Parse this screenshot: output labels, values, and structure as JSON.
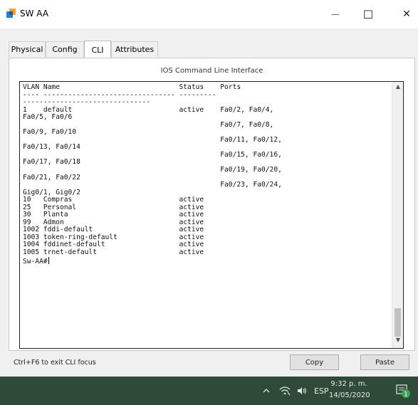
{
  "window": {
    "title": "SW AA",
    "minimize_glyph": "—",
    "maximize_glyph": "☐",
    "close_glyph": "✕"
  },
  "tabs": [
    {
      "label": "Physical"
    },
    {
      "label": "Config"
    },
    {
      "label": "CLI"
    },
    {
      "label": "Attributes"
    }
  ],
  "active_tab": "CLI",
  "cli": {
    "title": "IOS Command Line Interface",
    "lines": [
      "VLAN Name                             Status    Ports",
      "---- -------------------------------- ---------",
      "-------------------------------",
      "1    default                          active    Fa0/2, Fa0/4,",
      "Fa0/5, Fa0/6",
      "                                                Fa0/7, Fa0/8,",
      "Fa0/9, Fa0/10",
      "                                                Fa0/11, Fa0/12,",
      "Fa0/13, Fa0/14",
      "                                                Fa0/15, Fa0/16,",
      "Fa0/17, Fa0/18",
      "                                                Fa0/19, Fa0/20,",
      "Fa0/21, Fa0/22",
      "                                                Fa0/23, Fa0/24,",
      "Gig0/1, Gig0/2",
      "10   Compras                          active",
      "25   Personal                         active",
      "30   Planta                           active",
      "99   Admon                            active",
      "1002 fddi-default                     active",
      "1003 token-ring-default               active",
      "1004 fddinet-default                  active",
      "1005 trnet-default                    active"
    ],
    "prompt": "Sw-AA#"
  },
  "footer": {
    "hint": "Ctrl+F6 to exit CLI focus",
    "copy_label": "Copy",
    "paste_label": "Paste"
  },
  "taskbar": {
    "lang": "ESP",
    "time": "9:32 p. m.",
    "date": "14/05/2020",
    "notification_count": "1"
  },
  "colors": {
    "taskbar": "#2f4a37",
    "notification_badge": "#3aa655"
  }
}
